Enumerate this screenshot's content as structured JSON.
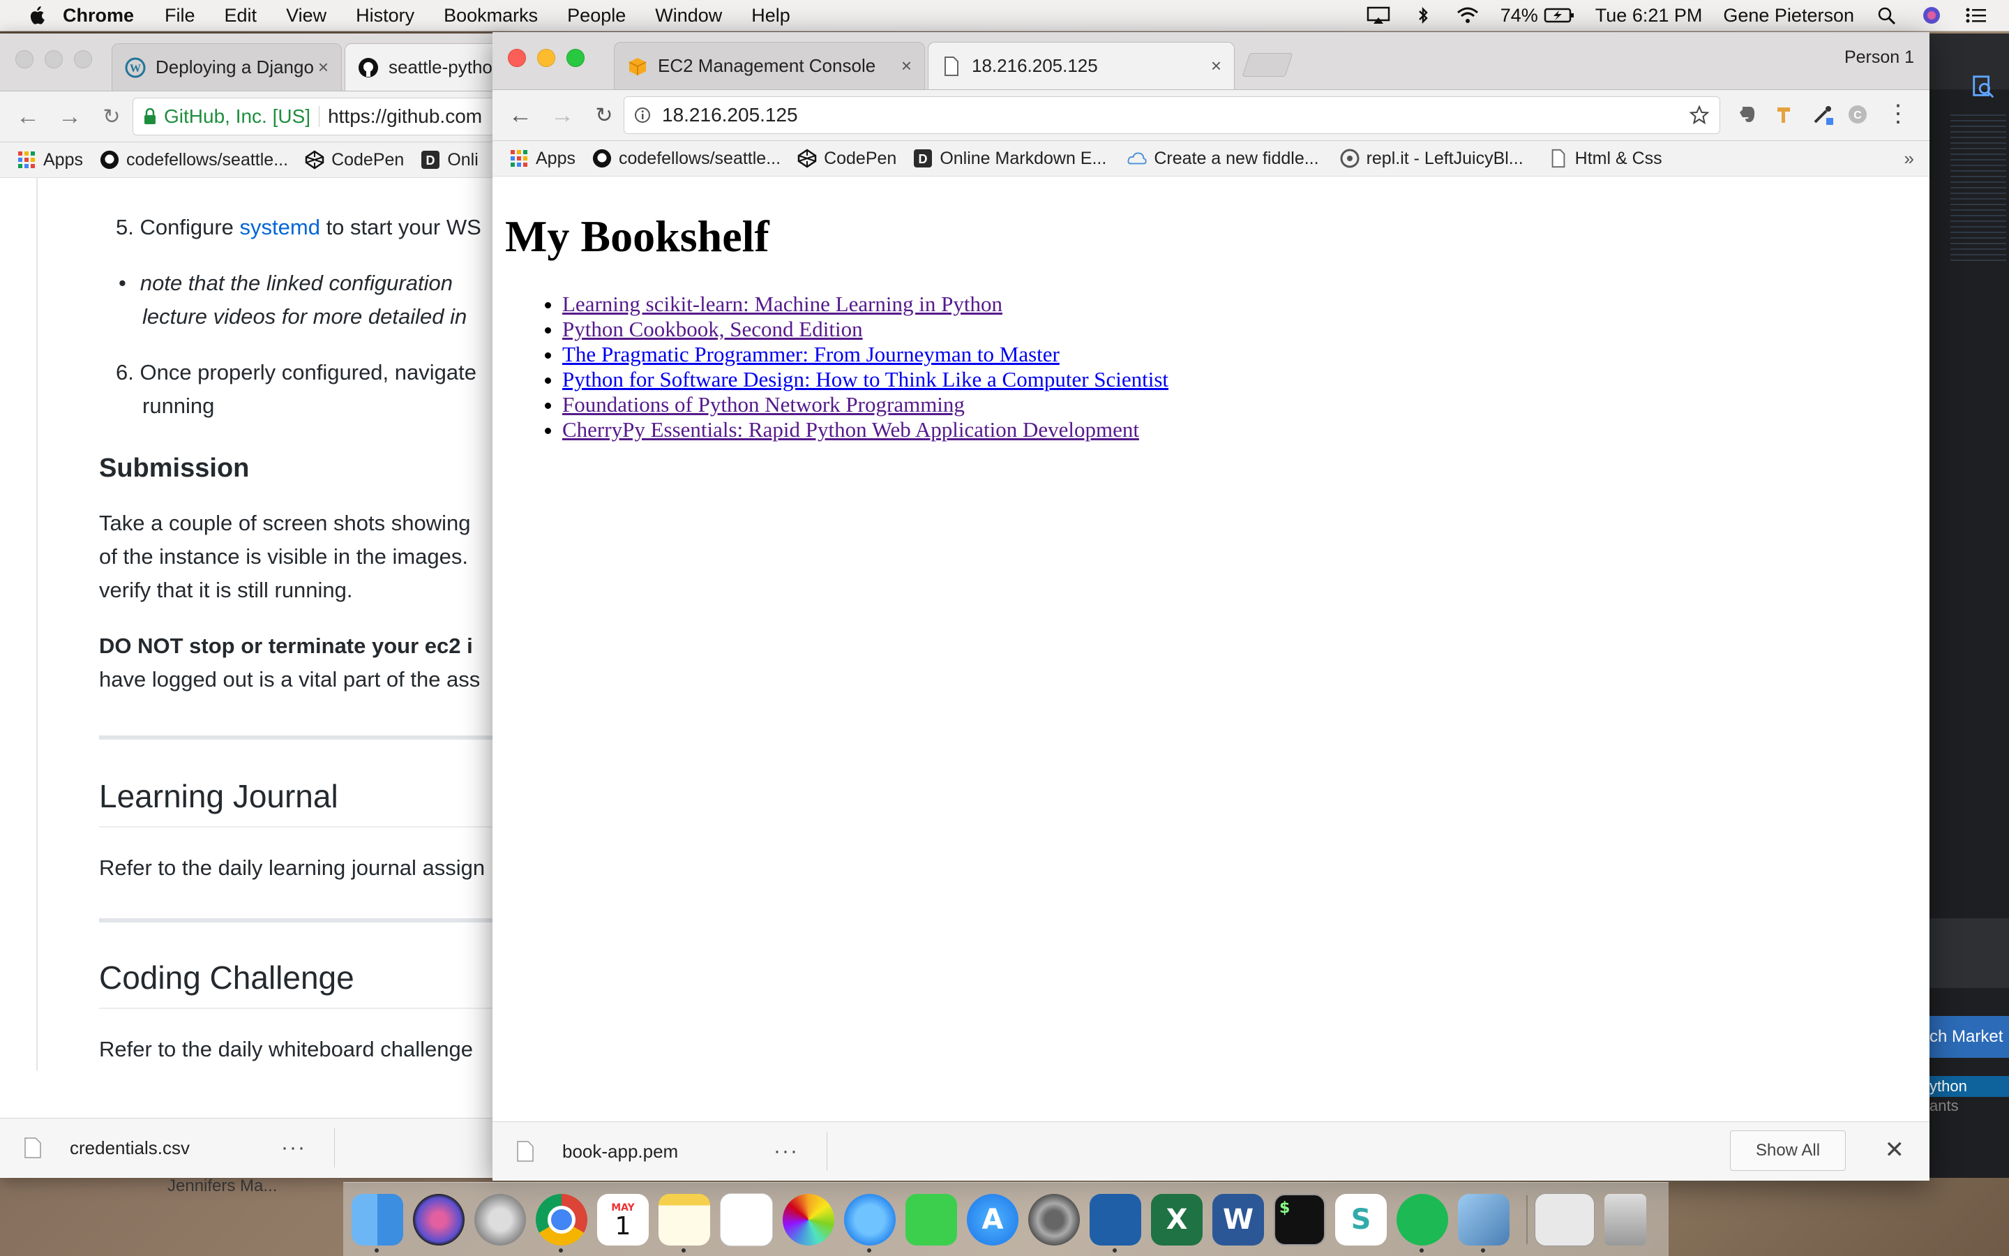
{
  "menubar": {
    "app_name": "Chrome",
    "menus": [
      "File",
      "Edit",
      "View",
      "History",
      "Bookmarks",
      "People",
      "Window",
      "Help"
    ],
    "battery": "74%",
    "clock": "Tue 6:21 PM",
    "user": "Gene Pieterson"
  },
  "back_window": {
    "tabs": [
      {
        "title": "Deploying a Django",
        "icon": "wordpress-icon"
      },
      {
        "title": "seattle-pytho",
        "icon": "github-icon"
      }
    ],
    "site_identity": "GitHub, Inc. [US]",
    "url": "https://github.com",
    "bookmarks": [
      "Apps",
      "codefellows/seattle...",
      "CodePen",
      "Onli"
    ],
    "content": {
      "step5_prefix": "5. Configure",
      "step5_link": "systemd",
      "step5_suffix": "to start your WS",
      "note_line1": "note that the linked configuration",
      "note_line2": "lecture videos for more detailed in",
      "step6_line1": "6. Once properly configured, navigate",
      "step6_line2": "running",
      "submission_heading": "Submission",
      "submission_line1": "Take a couple of screen shots showing",
      "submission_line2": "of the instance is visible in the images.",
      "submission_line3": "verify that it is still running.",
      "warning_bold": "DO NOT stop or terminate your ec2 i",
      "warning_line2": "have logged out is a vital part of the ass",
      "journal_heading": "Learning Journal",
      "journal_text": "Refer to the daily learning journal assign",
      "challenge_heading": "Coding Challenge",
      "challenge_text": "Refer to the daily whiteboard challenge"
    },
    "download_file": "credentials.csv",
    "behind_text": "Jennifers Ma..."
  },
  "front_window": {
    "person_label": "Person 1",
    "tabs": [
      {
        "title": "EC2 Management Console",
        "icon": "aws-cube-icon"
      },
      {
        "title": "18.216.205.125",
        "icon": "page-icon"
      }
    ],
    "url": "18.216.205.125",
    "bookmarks": [
      {
        "label": "Apps",
        "icon": "apps-grid-icon"
      },
      {
        "label": "codefellows/seattle...",
        "icon": "github-icon"
      },
      {
        "label": "CodePen",
        "icon": "codepen-icon"
      },
      {
        "label": "Online Markdown E...",
        "icon": "dillinger-icon"
      },
      {
        "label": "Create a new fiddle...",
        "icon": "jsfiddle-icon"
      },
      {
        "label": "repl.it - LeftJuicyBl...",
        "icon": "replit-icon"
      },
      {
        "label": "Html & Css",
        "icon": "page-icon"
      }
    ],
    "page": {
      "heading": "My Bookshelf",
      "books": [
        "Learning scikit-learn: Machine Learning in Python",
        "Python Cookbook, Second Edition",
        "The Pragmatic Programmer: From Journeyman to Master",
        "Python for Software Design: How to Think Like a Computer Scientist",
        "Foundations of Python Network Programming",
        "CherryPy Essentials: Rapid Python Web Application Development"
      ]
    },
    "download_file": "book-app.pem",
    "show_all": "Show All"
  },
  "side_strip": {
    "marketplace_text": "ch Market",
    "python_text": "ython",
    "ants_text": "ants"
  },
  "dock": [
    "finder-icon",
    "siri-icon",
    "launchpad-icon",
    "chrome-icon",
    "calendar-icon",
    "notes-icon",
    "reminders-icon",
    "photos-icon",
    "messages-icon",
    "facetime-icon",
    "app-store-icon",
    "system-preferences-icon",
    "vscode-icon",
    "excel-icon",
    "word-icon",
    "terminal-icon",
    "slack-icon",
    "spotify-icon",
    "preview-icon",
    "downloads-stack-icon",
    "trash-icon"
  ],
  "calendar_month": "MAY",
  "calendar_day": "1",
  "colors": {
    "link_visited": "#551a8b",
    "link_unvisited": "#0000ee",
    "github_link": "#0366d6",
    "secure_green": "#1e8e3e"
  }
}
